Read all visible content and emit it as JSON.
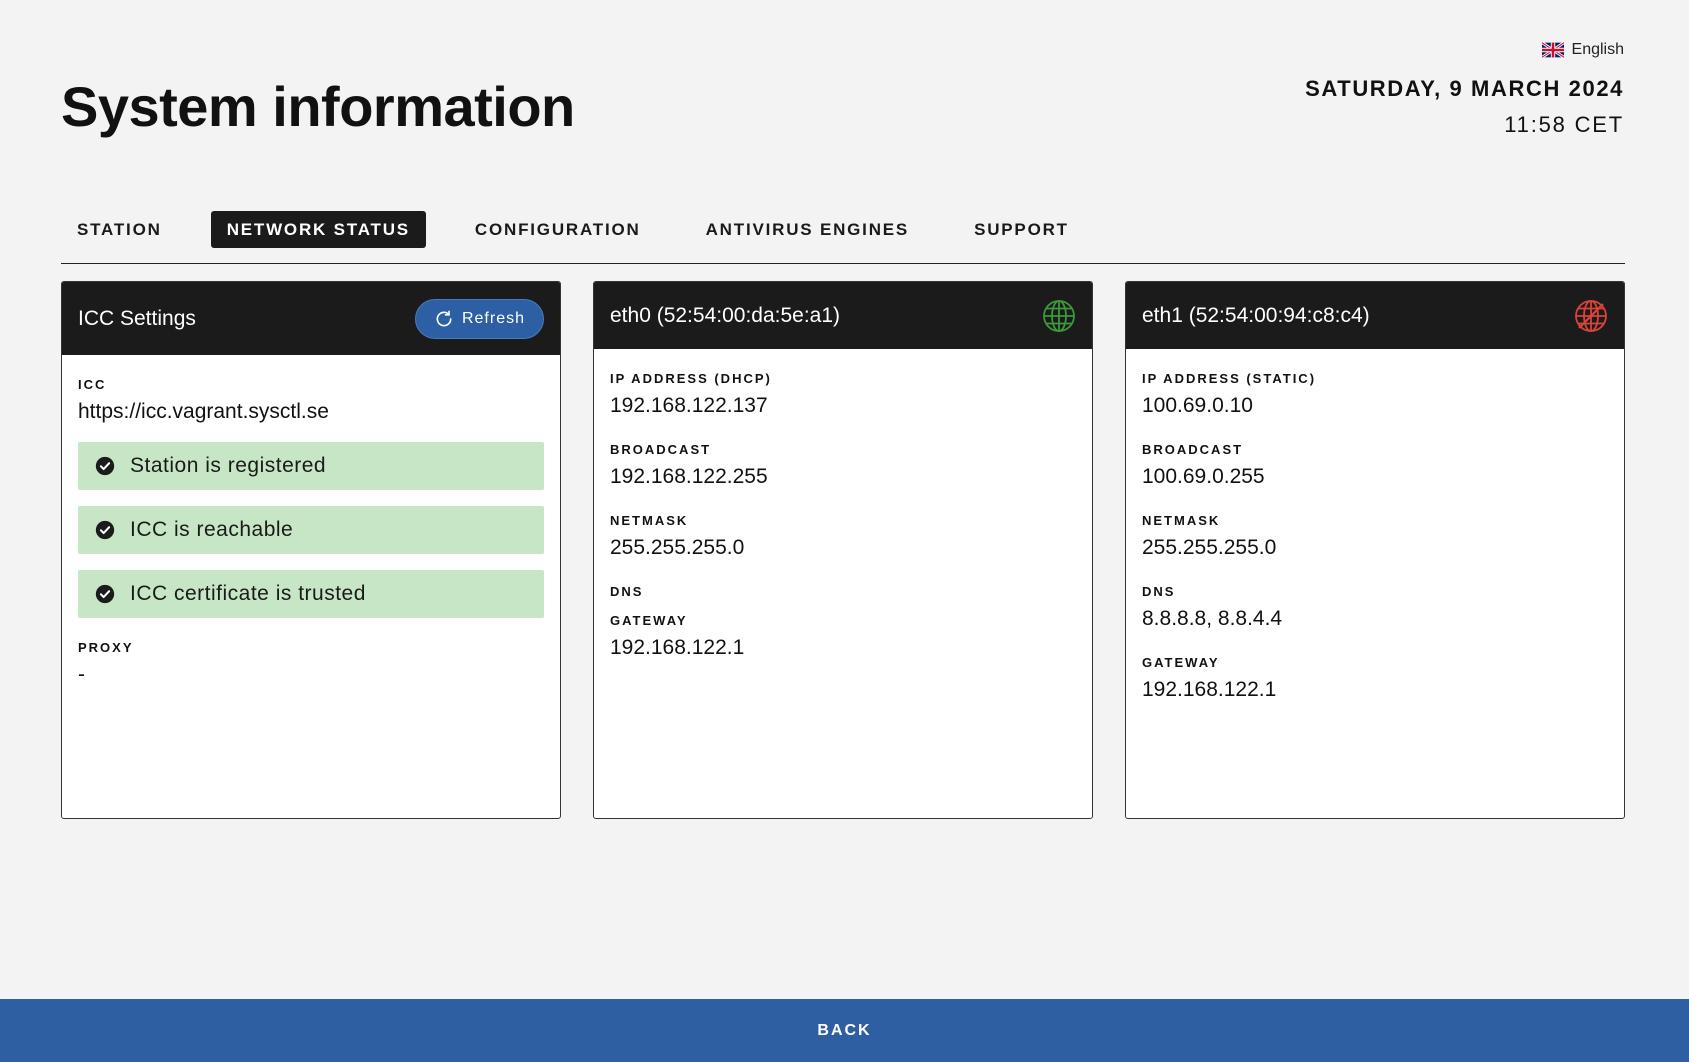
{
  "header": {
    "title": "System information",
    "language": "English",
    "date": "SATURDAY, 9 MARCH 2024",
    "time": "11:58 CET"
  },
  "tabs": [
    {
      "label": "STATION",
      "active": false
    },
    {
      "label": "NETWORK STATUS",
      "active": true
    },
    {
      "label": "CONFIGURATION",
      "active": false
    },
    {
      "label": "ANTIVIRUS ENGINES",
      "active": false
    },
    {
      "label": "SUPPORT",
      "active": false
    }
  ],
  "icc_card": {
    "title": "ICC Settings",
    "refresh_label": "Refresh",
    "icc_label": "ICC",
    "icc_value": "https://icc.vagrant.sysctl.se",
    "statuses": [
      "Station is registered",
      "ICC is reachable",
      "ICC certificate is trusted"
    ],
    "proxy_label": "PROXY",
    "proxy_value": "-"
  },
  "eth0": {
    "title": "eth0 (52:54:00:da:5e:a1)",
    "icon": "globe-connected-icon",
    "ip_label": "IP ADDRESS (DHCP)",
    "ip_value": "192.168.122.137",
    "broadcast_label": "BROADCAST",
    "broadcast_value": "192.168.122.255",
    "netmask_label": "NETMASK",
    "netmask_value": "255.255.255.0",
    "dns_label": "DNS",
    "dns_value": "",
    "gateway_label": "GATEWAY",
    "gateway_value": "192.168.122.1"
  },
  "eth1": {
    "title": "eth1 (52:54:00:94:c8:c4)",
    "icon": "globe-disconnected-icon",
    "ip_label": "IP ADDRESS (STATIC)",
    "ip_value": "100.69.0.10",
    "broadcast_label": "BROADCAST",
    "broadcast_value": "100.69.0.255",
    "netmask_label": "NETMASK",
    "netmask_value": "255.255.255.0",
    "dns_label": "DNS",
    "dns_value": "8.8.8.8, 8.8.4.4",
    "gateway_label": "GATEWAY",
    "gateway_value": "192.168.122.1"
  },
  "footer": {
    "back_label": "BACK"
  },
  "colors": {
    "accent": "#2e5fa2",
    "success_bg": "#c7e6c6",
    "connected": "#3a9a3a",
    "disconnected": "#d9443a",
    "dark": "#1b1b1b"
  }
}
